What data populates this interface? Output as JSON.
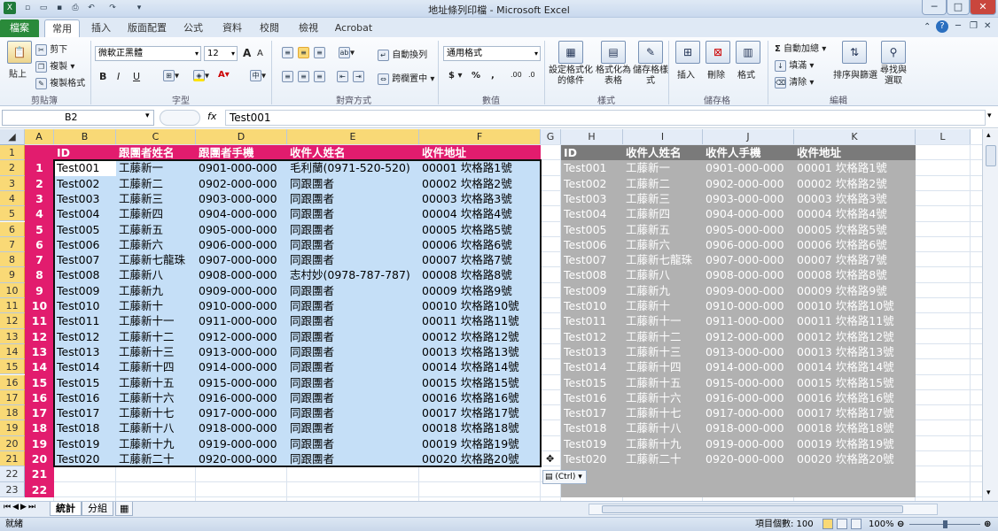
{
  "window": {
    "title": "地址條列印檔 - Microsoft Excel",
    "minimize": "─",
    "maximize": "□",
    "close": "✕"
  },
  "ribbon_tabs": [
    "檔案",
    "常用",
    "插入",
    "版面配置",
    "公式",
    "資料",
    "校閱",
    "檢視",
    "Acrobat"
  ],
  "ribbon": {
    "clipboard": {
      "paste": "貼上",
      "cut": "剪下",
      "copy": "複製",
      "format_painter": "複製格式",
      "label": "剪貼簿"
    },
    "font": {
      "name": "微軟正黑體",
      "size": "12",
      "bold": "B",
      "italic": "I",
      "underline": "U",
      "grow": "A",
      "shrink": "A",
      "label": "字型"
    },
    "alignment": {
      "wrap": "自動換列",
      "merge": "跨欄置中",
      "label": "對齊方式"
    },
    "number": {
      "format": "通用格式",
      "currency": "$",
      "percent": "%",
      "comma": ",",
      "inc_decimal": ".00",
      "dec_decimal": ".0",
      "label": "數值"
    },
    "styles": {
      "conditional": "設定格式化的條件",
      "as_table": "格式化為表格",
      "cell_styles": "儲存格樣式",
      "label": "樣式"
    },
    "cells": {
      "insert": "插入",
      "delete": "刪除",
      "format": "格式",
      "label": "儲存格"
    },
    "editing": {
      "autosum": "自動加總",
      "fill": "填滿",
      "clear": "清除",
      "sort_filter": "排序與篩選",
      "find_select": "尋找與選取",
      "label": "編輯"
    }
  },
  "formula_bar": {
    "name_box": "B2",
    "fx": "fx",
    "content": "Test001"
  },
  "columns": [
    "A",
    "B",
    "C",
    "D",
    "E",
    "F",
    "G",
    "H",
    "I",
    "J",
    "K",
    "L"
  ],
  "rows": [
    "1",
    "2",
    "3",
    "4",
    "5",
    "6",
    "7",
    "8",
    "9",
    "10",
    "11",
    "12",
    "13",
    "14",
    "15",
    "16",
    "17",
    "18",
    "19",
    "20",
    "21",
    "22",
    "23"
  ],
  "left_table": {
    "headers": [
      "ID",
      "跟團者姓名",
      "跟團者手機",
      "收件人姓名",
      "收件地址"
    ],
    "rows": [
      [
        "1",
        "Test001",
        "工藤新一",
        "0901-000-000",
        "毛利蘭(0971-520-520)",
        "00001 坎格路1號"
      ],
      [
        "2",
        "Test002",
        "工藤新二",
        "0902-000-000",
        "同跟團者",
        "00002 坎格路2號"
      ],
      [
        "3",
        "Test003",
        "工藤新三",
        "0903-000-000",
        "同跟團者",
        "00003 坎格路3號"
      ],
      [
        "4",
        "Test004",
        "工藤新四",
        "0904-000-000",
        "同跟團者",
        "00004 坎格路4號"
      ],
      [
        "5",
        "Test005",
        "工藤新五",
        "0905-000-000",
        "同跟團者",
        "00005 坎格路5號"
      ],
      [
        "6",
        "Test006",
        "工藤新六",
        "0906-000-000",
        "同跟團者",
        "00006 坎格路6號"
      ],
      [
        "7",
        "Test007",
        "工藤新七龍珠",
        "0907-000-000",
        "同跟團者",
        "00007 坎格路7號"
      ],
      [
        "8",
        "Test008",
        "工藤新八",
        "0908-000-000",
        "志村妙(0978-787-787)",
        "00008 坎格路8號"
      ],
      [
        "9",
        "Test009",
        "工藤新九",
        "0909-000-000",
        "同跟團者",
        "00009 坎格路9號"
      ],
      [
        "10",
        "Test010",
        "工藤新十",
        "0910-000-000",
        "同跟團者",
        "00010 坎格路10號"
      ],
      [
        "11",
        "Test011",
        "工藤新十一",
        "0911-000-000",
        "同跟團者",
        "00011 坎格路11號"
      ],
      [
        "12",
        "Test012",
        "工藤新十二",
        "0912-000-000",
        "同跟團者",
        "00012 坎格路12號"
      ],
      [
        "13",
        "Test013",
        "工藤新十三",
        "0913-000-000",
        "同跟團者",
        "00013 坎格路13號"
      ],
      [
        "14",
        "Test014",
        "工藤新十四",
        "0914-000-000",
        "同跟團者",
        "00014 坎格路14號"
      ],
      [
        "15",
        "Test015",
        "工藤新十五",
        "0915-000-000",
        "同跟團者",
        "00015 坎格路15號"
      ],
      [
        "16",
        "Test016",
        "工藤新十六",
        "0916-000-000",
        "同跟團者",
        "00016 坎格路16號"
      ],
      [
        "17",
        "Test017",
        "工藤新十七",
        "0917-000-000",
        "同跟團者",
        "00017 坎格路17號"
      ],
      [
        "18",
        "Test018",
        "工藤新十八",
        "0918-000-000",
        "同跟團者",
        "00018 坎格路18號"
      ],
      [
        "19",
        "Test019",
        "工藤新十九",
        "0919-000-000",
        "同跟團者",
        "00019 坎格路19號"
      ],
      [
        "20",
        "Test020",
        "工藤新二十",
        "0920-000-000",
        "同跟團者",
        "00020 坎格路20號"
      ]
    ],
    "extra_a": [
      "21",
      "22"
    ]
  },
  "right_table": {
    "headers": [
      "ID",
      "收件人姓名",
      "收件人手機",
      "收件地址"
    ],
    "rows": [
      [
        "Test001",
        "工藤新一",
        "0901-000-000",
        "00001 坎格路1號"
      ],
      [
        "Test002",
        "工藤新二",
        "0902-000-000",
        "00002 坎格路2號"
      ],
      [
        "Test003",
        "工藤新三",
        "0903-000-000",
        "00003 坎格路3號"
      ],
      [
        "Test004",
        "工藤新四",
        "0904-000-000",
        "00004 坎格路4號"
      ],
      [
        "Test005",
        "工藤新五",
        "0905-000-000",
        "00005 坎格路5號"
      ],
      [
        "Test006",
        "工藤新六",
        "0906-000-000",
        "00006 坎格路6號"
      ],
      [
        "Test007",
        "工藤新七龍珠",
        "0907-000-000",
        "00007 坎格路7號"
      ],
      [
        "Test008",
        "工藤新八",
        "0908-000-000",
        "00008 坎格路8號"
      ],
      [
        "Test009",
        "工藤新九",
        "0909-000-000",
        "00009 坎格路9號"
      ],
      [
        "Test010",
        "工藤新十",
        "0910-000-000",
        "00010 坎格路10號"
      ],
      [
        "Test011",
        "工藤新十一",
        "0911-000-000",
        "00011 坎格路11號"
      ],
      [
        "Test012",
        "工藤新十二",
        "0912-000-000",
        "00012 坎格路12號"
      ],
      [
        "Test013",
        "工藤新十三",
        "0913-000-000",
        "00013 坎格路13號"
      ],
      [
        "Test014",
        "工藤新十四",
        "0914-000-000",
        "00014 坎格路14號"
      ],
      [
        "Test015",
        "工藤新十五",
        "0915-000-000",
        "00015 坎格路15號"
      ],
      [
        "Test016",
        "工藤新十六",
        "0916-000-000",
        "00016 坎格路16號"
      ],
      [
        "Test017",
        "工藤新十七",
        "0917-000-000",
        "00017 坎格路17號"
      ],
      [
        "Test018",
        "工藤新十八",
        "0918-000-000",
        "00018 坎格路18號"
      ],
      [
        "Test019",
        "工藤新十九",
        "0919-000-000",
        "00019 坎格路19號"
      ],
      [
        "Test020",
        "工藤新二十",
        "0920-000-000",
        "00020 坎格路20號"
      ]
    ]
  },
  "paste_options": "(Ctrl)",
  "sheets": [
    "統計",
    "分組"
  ],
  "status": {
    "mode": "就緒",
    "count_label": "項目個數: 100",
    "zoom": "100%"
  },
  "colors": {
    "header_pink": "#e21c6e",
    "selection_blue": "#c5dff7",
    "right_gray": "#b1b1b1",
    "right_header": "#7a7a7a"
  }
}
